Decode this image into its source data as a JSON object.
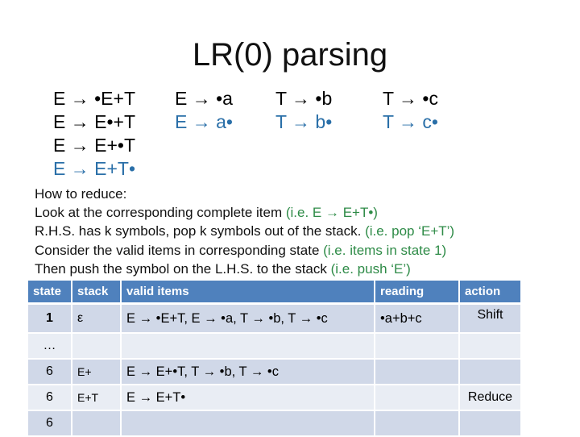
{
  "title": "LR(0) parsing",
  "grammar": {
    "columns": [
      {
        "rules": [
          {
            "text": "E → •E+T",
            "complete": false
          },
          {
            "text": "E → E•+T",
            "complete": false
          },
          {
            "text": "E → E+•T",
            "complete": false
          },
          {
            "text": "E → E+T•",
            "complete": true
          }
        ]
      },
      {
        "rules": [
          {
            "text": "E → •a",
            "complete": false
          },
          {
            "text": "E → a•",
            "complete": true
          }
        ]
      },
      {
        "rules": [
          {
            "text": "T → •b",
            "complete": false
          },
          {
            "text": "T → b•",
            "complete": true
          }
        ]
      },
      {
        "rules": [
          {
            "text": "T → •c",
            "complete": false
          },
          {
            "text": "T → c•",
            "complete": true
          }
        ]
      }
    ]
  },
  "explanation": {
    "heading": "How to reduce:",
    "lines": [
      {
        "text": "Look at the corresponding complete item ",
        "hint": "(i.e. E → E+T•)"
      },
      {
        "text": "R.H.S. has k symbols, pop k symbols out  of the stack. ",
        "hint": "(i.e. pop ‘E+T’)"
      },
      {
        "text": "Consider the valid items in corresponding state ",
        "hint": "(i.e. items in state 1)"
      },
      {
        "text": "Then push the symbol on the L.H.S. to the stack ",
        "hint": "(i.e. push ‘E’)"
      }
    ]
  },
  "table": {
    "headers": {
      "state": "state",
      "stack": "stack",
      "items": "valid items",
      "reading": "reading",
      "action": "action"
    },
    "rows": [
      {
        "state": "1",
        "stack": "ε",
        "items": "E → •E+T, E → •a, T → •b, T → •c",
        "reading": "•a+b+c",
        "action": "Shift"
      },
      {
        "state": "…",
        "stack": "",
        "items": "",
        "reading": "",
        "action": ""
      },
      {
        "state": "6",
        "stack": "E+",
        "items": "E → E+•T, T → •b, T → •c",
        "reading": "",
        "action": ""
      },
      {
        "state": "6",
        "stack": "E+T",
        "items": "E → E+T•",
        "reading": "",
        "action": "Reduce"
      },
      {
        "state": "6",
        "stack": "",
        "items": "",
        "reading": "",
        "action": ""
      }
    ]
  },
  "colors": {
    "header_bg": "#4f81bd",
    "row_odd": "#d0d8e8",
    "row_even": "#e9edf4",
    "complete_item": "#2a6fa8",
    "hint": "#2e8b47"
  }
}
